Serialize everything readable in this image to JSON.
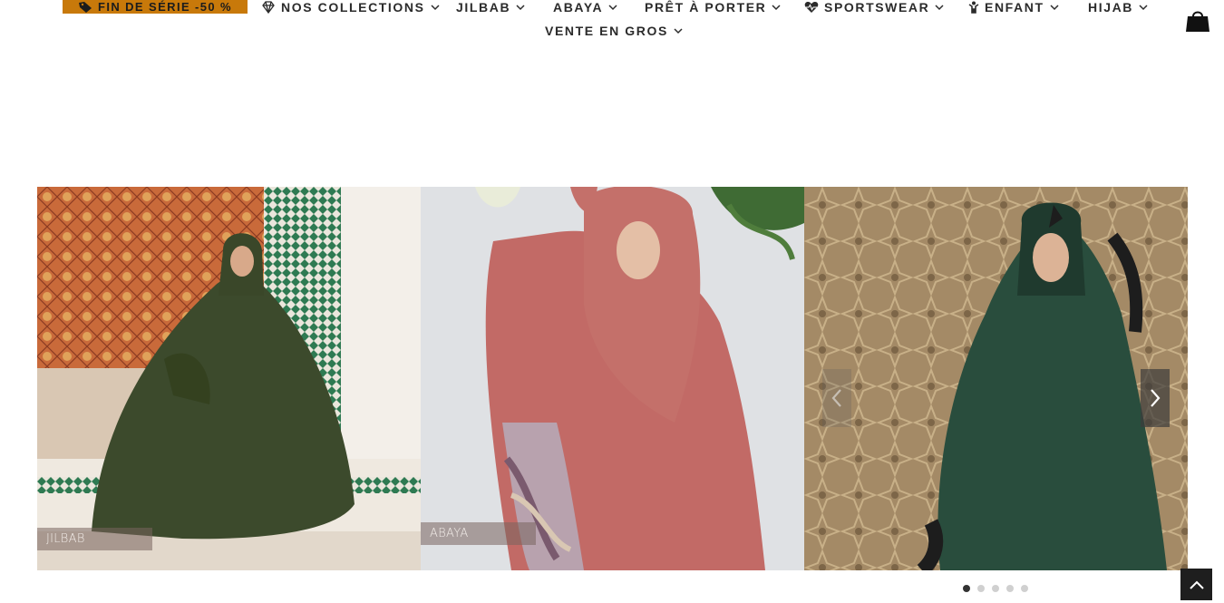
{
  "nav": {
    "promo_label": "FIN DE SÉRIE -50 %",
    "items": [
      {
        "label": "NOS COLLECTIONS",
        "icon": "diamond-icon"
      },
      {
        "label": "JILBAB"
      },
      {
        "label": "ABAYA"
      },
      {
        "label": "PRÊT À PORTER"
      },
      {
        "label": "SPORTSWEAR",
        "icon": "heartbeat-icon"
      },
      {
        "label": "ENFANT",
        "icon": "child-icon"
      },
      {
        "label": "HIJAB"
      },
      {
        "label": "VENTE EN GROS"
      }
    ],
    "cart_icon": "shopping-bag-icon"
  },
  "slider": {
    "slides": [
      {
        "caption": "JILBAB"
      },
      {
        "caption": "ABAYA"
      },
      {
        "caption": ""
      }
    ],
    "dot_count": 5,
    "active_dot": 0
  },
  "colors": {
    "promo_bg": "#c8790a",
    "nav_text": "#2b2b2b",
    "back_to_top_bg": "#1e1e1e"
  }
}
